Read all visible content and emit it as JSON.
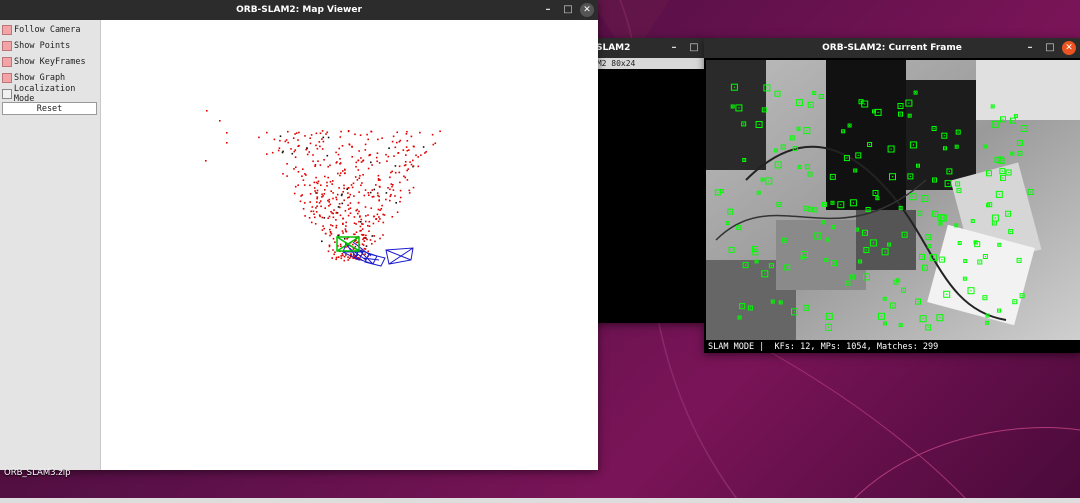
{
  "map_viewer": {
    "title": "ORB-SLAM2: Map Viewer",
    "options": [
      {
        "label": "Follow Camera",
        "checked": true
      },
      {
        "label": "Show Points",
        "checked": true
      },
      {
        "label": "Show KeyFrames",
        "checked": true
      },
      {
        "label": "Show Graph",
        "checked": true
      },
      {
        "label": "Localization Mode",
        "checked": false
      }
    ],
    "reset_label": "Reset",
    "colors": {
      "map_points": "#e00000",
      "keyframes": "#1a1acc",
      "current_camera": "#00c000"
    }
  },
  "terminal": {
    "title": "SLAM2",
    "tab_label": "AM2 80x24"
  },
  "current_frame": {
    "title": "ORB-SLAM2: Current Frame",
    "status": "SLAM MODE |  KFs: 12, MPs: 1054, Matches: 299",
    "feature_color": "#00ff00"
  },
  "desktop": {
    "file_label": "ORB_SLAM3.zip"
  },
  "icons": [
    "minimize-icon",
    "maximize-icon",
    "close-icon"
  ]
}
